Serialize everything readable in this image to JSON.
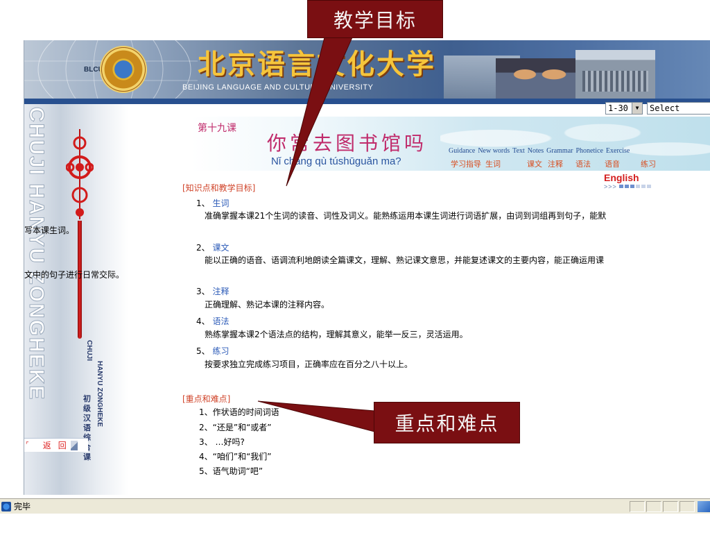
{
  "banner": {
    "logo_label": "BLCU",
    "university_cn": "北京语言文化大学",
    "university_en": "BEIJING LANGUAGE AND CULTURE UNIVERSITY"
  },
  "controls": {
    "range_select": "1-30",
    "lesson_select": "Select"
  },
  "sidebar": {
    "vertical_title": "CHUJI HANYU ZONGHEKE",
    "small_en_1": "CHUJI",
    "small_en_2": "HANYU ZONGHEKE",
    "small_cn": "初级汉语综合课",
    "back_label": "返回"
  },
  "lesson": {
    "number": "第十九课",
    "title": "你常去图书馆吗",
    "pinyin": "Nǐ cháng qù túshūguǎn ma?"
  },
  "nav": {
    "en": [
      "Guidance",
      "New words",
      "Text",
      "Notes",
      "Grammar",
      "Phonetice",
      "Exercise"
    ],
    "cn": [
      "学习指导",
      "生词",
      "课文",
      "注释",
      "语法",
      "语音",
      "练习"
    ]
  },
  "english_link": "English",
  "english_arrows": ">>>",
  "sections": {
    "objectives_heading": "[知识点和教学目标]",
    "objectives": [
      {
        "no": "1、",
        "title": "生词",
        "lines": [
          "准确掌握本课21个生词的读音、词性及词义。能熟练运用本课生词进行词语扩展，由词到词组再到句子，能默",
          "写本课生词。"
        ]
      },
      {
        "no": "2、",
        "title": "课文",
        "lines": [
          "能以正确的语音、语调流利地朗读全篇课文，理解、熟记课文意思，并能复述课文的主要内容，能正确运用课",
          "文中的句子进行日常交际。"
        ]
      },
      {
        "no": "3、",
        "title": "注释",
        "lines": [
          "正确理解、熟记本课的注释内容。"
        ]
      },
      {
        "no": "4、",
        "title": "语法",
        "lines": [
          "熟练掌握本课2个语法点的结构，理解其意义，能举一反三，灵活运用。"
        ]
      },
      {
        "no": "5、",
        "title": "练习",
        "lines": [
          "按要求独立完成练习项目，正确率应在百分之八十以上。"
        ]
      }
    ],
    "keypoints_heading": "[重点和难点]",
    "keypoints": [
      "1、作状语的时间词语",
      "2、“还是”和“或者”",
      "3、 …好吗?",
      "4、“咱们”和“我们”",
      "5、语气助词“吧”"
    ]
  },
  "callouts": {
    "top": "教学目标",
    "bottom": "重点和难点"
  },
  "status": {
    "text": "完毕"
  },
  "colors": {
    "callout_bg": "#7a0f12",
    "section_heading": "#d0442a",
    "link_blue": "#2c5bb8",
    "lesson_title": "#c02b6b"
  }
}
